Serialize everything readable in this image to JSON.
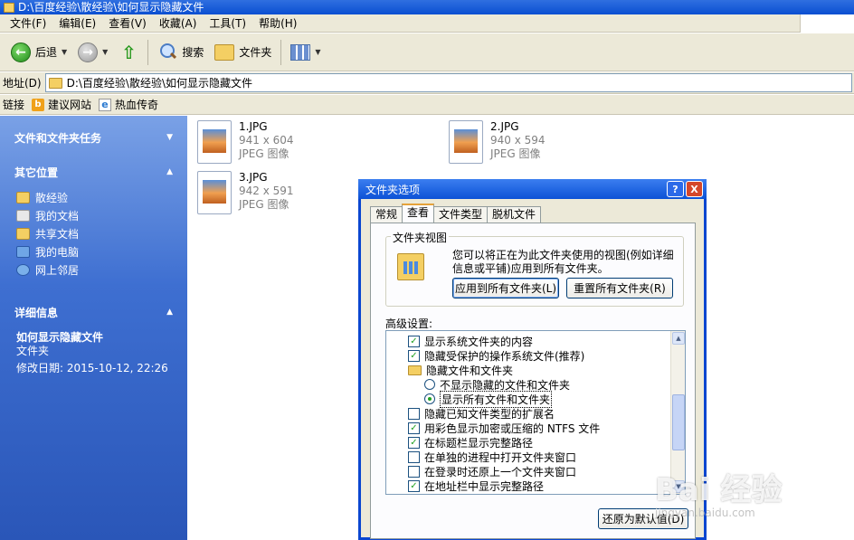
{
  "window": {
    "title": "D:\\百度经验\\散经验\\如何显示隐藏文件"
  },
  "menu": [
    "文件(F)",
    "编辑(E)",
    "查看(V)",
    "收藏(A)",
    "工具(T)",
    "帮助(H)"
  ],
  "toolbar": {
    "back_label": "后退",
    "search_label": "搜索",
    "folders_label": "文件夹"
  },
  "address": {
    "label": "地址(D)",
    "path": "D:\\百度经验\\散经验\\如何显示隐藏文件"
  },
  "links": {
    "label": "链接",
    "items": [
      "建议网站",
      "热血传奇"
    ]
  },
  "taskpane": {
    "file_tasks_title": "文件和文件夹任务",
    "other_places_title": "其它位置",
    "other_places": [
      "散经验",
      "我的文档",
      "共享文档",
      "我的电脑",
      "网上邻居"
    ],
    "details_title": "详细信息",
    "details_name": "如何显示隐藏文件",
    "details_type": "文件夹",
    "details_modified": "修改日期: 2015-10-12, 22:26"
  },
  "files": [
    {
      "name": "1.JPG",
      "dims": "941 x 604",
      "type": "JPEG 图像"
    },
    {
      "name": "2.JPG",
      "dims": "940 x 594",
      "type": "JPEG 图像"
    },
    {
      "name": "3.JPG",
      "dims": "942 x 591",
      "type": "JPEG 图像"
    }
  ],
  "dialog": {
    "title": "文件夹选项",
    "help_glyph": "?",
    "close_glyph": "X",
    "tabs": [
      "常规",
      "查看",
      "文件类型",
      "脱机文件"
    ],
    "active_tab": "查看",
    "folder_views_legend": "文件夹视图",
    "folder_views_desc": "您可以将正在为此文件夹使用的视图(例如详细信息或平铺)应用到所有文件夹。",
    "apply_all_label": "应用到所有文件夹(L)",
    "reset_all_label": "重置所有文件夹(R)",
    "advanced_label": "高级设置:",
    "advanced_items": [
      {
        "kind": "checkbox",
        "checked": true,
        "text": "显示系统文件夹的内容"
      },
      {
        "kind": "checkbox",
        "checked": true,
        "text": "隐藏受保护的操作系统文件(推荐)"
      },
      {
        "kind": "folder",
        "text": "隐藏文件和文件夹"
      },
      {
        "kind": "radio",
        "checked": false,
        "text": "不显示隐藏的文件和文件夹"
      },
      {
        "kind": "radio",
        "checked": true,
        "text": "显示所有文件和文件夹"
      },
      {
        "kind": "checkbox",
        "checked": false,
        "text": "隐藏已知文件类型的扩展名"
      },
      {
        "kind": "checkbox",
        "checked": true,
        "text": "用彩色显示加密或压缩的 NTFS 文件"
      },
      {
        "kind": "checkbox",
        "checked": true,
        "text": "在标题栏显示完整路径"
      },
      {
        "kind": "checkbox",
        "checked": false,
        "text": "在单独的进程中打开文件夹窗口"
      },
      {
        "kind": "checkbox",
        "checked": false,
        "text": "在登录时还原上一个文件夹窗口"
      },
      {
        "kind": "checkbox",
        "checked": true,
        "text": "在地址栏中显示完整路径"
      }
    ],
    "restore_defaults_label": "还原为默认值(D)"
  },
  "watermark": {
    "text": "Bai 经验",
    "sub": "jingyan.baidu.com"
  },
  "colors": {
    "taskpane_top": "#7aa1e6",
    "taskpane_bottom": "#2a56b8",
    "titlebar": "#0a4fd1",
    "dialog_bg": "#ece9d8"
  }
}
